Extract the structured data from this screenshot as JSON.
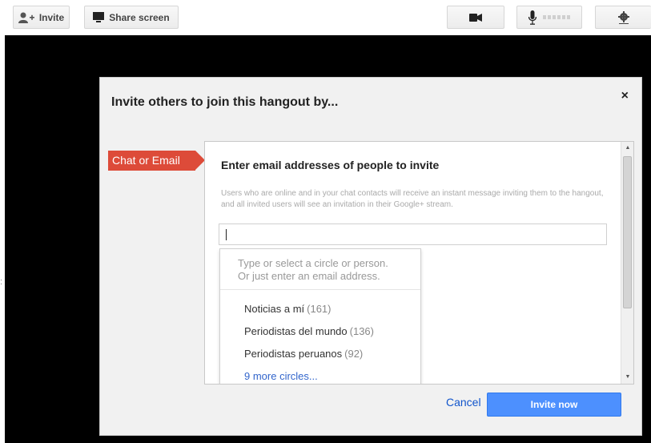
{
  "toolbar": {
    "invite_label": "Invite",
    "share_label": "Share screen",
    "icons": {
      "invite": "person-add-icon",
      "share": "monitor-icon",
      "camera": "video-camera-icon",
      "mic": "microphone-icon",
      "settings": "gear-icon"
    }
  },
  "modal": {
    "title": "Invite others to join this hangout by...",
    "close_glyph": "×",
    "tab_label": "Chat or Email",
    "panel": {
      "heading": "Enter email addresses of people to invite",
      "description": "Users who are online and in your chat contacts will receive an instant message inviting them to the hangout, and all invited users will see an invitation in their Google+ stream.",
      "input_value": ""
    },
    "dropdown": {
      "hint_line1": "Type or select a circle or person.",
      "hint_line2": "Or just enter an email address.",
      "items": [
        {
          "label": "Noticias a mí",
          "count": "(161)"
        },
        {
          "label": "Periodistas del mundo",
          "count": "(136)"
        },
        {
          "label": "Periodistas peruanos",
          "count": "(92)"
        }
      ],
      "more_label": "9 more circles..."
    },
    "cancel_label": "Cancel",
    "invite_now_label": "Invite now"
  },
  "colors": {
    "tab_red": "#dd4b39",
    "primary_blue": "#4d90fe",
    "link_blue": "#3366cc"
  }
}
